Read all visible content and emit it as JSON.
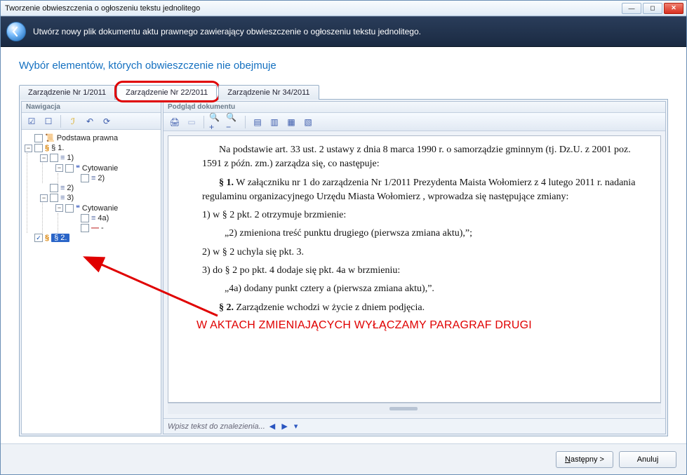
{
  "window": {
    "title": "Tworzenie obwieszczenia o ogłoszeniu tekstu jednolitego"
  },
  "header": {
    "text": "Utwórz nowy plik dokumentu aktu prawnego zawierający obwieszczenie o ogłoszeniu tekstu jednolitego."
  },
  "page_heading": "Wybór elementów, których obwieszczenie nie obejmuje",
  "tabs": [
    {
      "label": "Zarządzenie Nr 1/2011",
      "active": false,
      "highlighted": false
    },
    {
      "label": "Zarządzenie Nr 22/2011",
      "active": true,
      "highlighted": true
    },
    {
      "label": "Zarządzenie Nr 34/2011",
      "active": false,
      "highlighted": false
    }
  ],
  "panels": {
    "navigation_title": "Nawigacja",
    "document_title": "Podgląd dokumentu"
  },
  "nav_toolbar_icons": [
    "check-all",
    "uncheck-all",
    "wand",
    "refresh-left",
    "refresh"
  ],
  "tree": {
    "root_label": "Podstawa prawna",
    "s1": "§ 1.",
    "n1": "1)",
    "cyt1": "Cytowanie",
    "n1_2": "2)",
    "n2": "2)",
    "n3": "3)",
    "cyt2": "Cytowanie",
    "n4a": "4a)",
    "dash": "-",
    "s2": "§ 2.",
    "s2_checked": true
  },
  "doc_toolbar_icons": [
    "print",
    "page",
    "zoom-in",
    "zoom-out",
    "view-1",
    "view-2",
    "view-3",
    "view-4"
  ],
  "document": {
    "p1": "Na podstawie art. 33 ust. 2 ustawy z dnia 8 marca 1990 r. o samorządzie gminnym (tj. Dz.U. z 2001 poz. 1591 z późn. zm.) zarządza się, co następuje:",
    "p2_label": "§ 1.",
    "p2": " W załączniku nr 1 do zarządzenia Nr 1/2011 Prezydenta Maista Wołomierz z 4 lutego 2011 r. nadania regulaminu organizacyjnego Urzędu Miasta Wołomierz , wprowadza się następujące zmiany:",
    "p3": "1) w § 2 pkt. 2 otrzymuje brzmienie:",
    "p4": "„2) zmieniona treść punktu drugiego (pierwsza zmiana aktu),”;",
    "p5": "2) w § 2 uchyla się pkt. 3.",
    "p6": "3) do § 2 po pkt. 4 dodaje się pkt. 4a w brzmieniu:",
    "p7": "„4a) dodany punkt cztery a (pierwsza zmiana aktu),”.",
    "p8_label": "§ 2.",
    "p8": " Zarządzenie wchodzi w życie z dniem podjęcia."
  },
  "annotation": {
    "text": "W AKTACH ZMIENIAJĄCYCH WYŁĄCZAMY PARAGRAF DRUGI"
  },
  "search": {
    "placeholder": "Wpisz tekst do znalezienia..."
  },
  "buttons": {
    "next": "Następny >",
    "cancel": "Anuluj"
  }
}
